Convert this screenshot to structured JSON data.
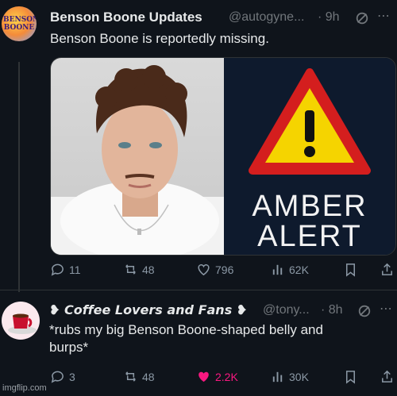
{
  "tweet1": {
    "avatar_text": "BENSON BOONE",
    "display_name": "Benson Boone Updates",
    "handle": "@autogyne...",
    "time": "· 9h",
    "text": "Benson Boone is reportedly missing.",
    "alert_line1": "AMBER",
    "alert_line2": "ALERT",
    "actions": {
      "replies": "11",
      "reposts": "48",
      "likes": "796",
      "views": "62K"
    }
  },
  "tweet2": {
    "display_name": "❥ 𝘾𝙤𝙛𝙛𝙚𝙚 𝙇𝙤𝙫𝙚𝙧𝙨 𝙖𝙣𝙙 𝙁𝙖𝙣𝙨 ❥",
    "handle": "@tony...",
    "time": "· 8h",
    "text_line1": "*rubs my big Benson Boone-shaped belly and",
    "text_line2": "burps*",
    "actions": {
      "replies": "3",
      "reposts": "48",
      "likes": "2.2K",
      "views": "30K"
    }
  },
  "watermark": "imgflip.com",
  "colors": {
    "background": "#0f141b",
    "muted": "#71767b",
    "like_active": "#f91880",
    "alert_bg": "#0e1a2d",
    "warning_yellow": "#f5d400",
    "warning_red": "#d41e1e"
  },
  "icons": [
    "grok-icon",
    "reply-icon",
    "repost-icon",
    "heart-icon",
    "views-icon",
    "bookmark-icon",
    "share-icon",
    "warning-sign-icon"
  ]
}
